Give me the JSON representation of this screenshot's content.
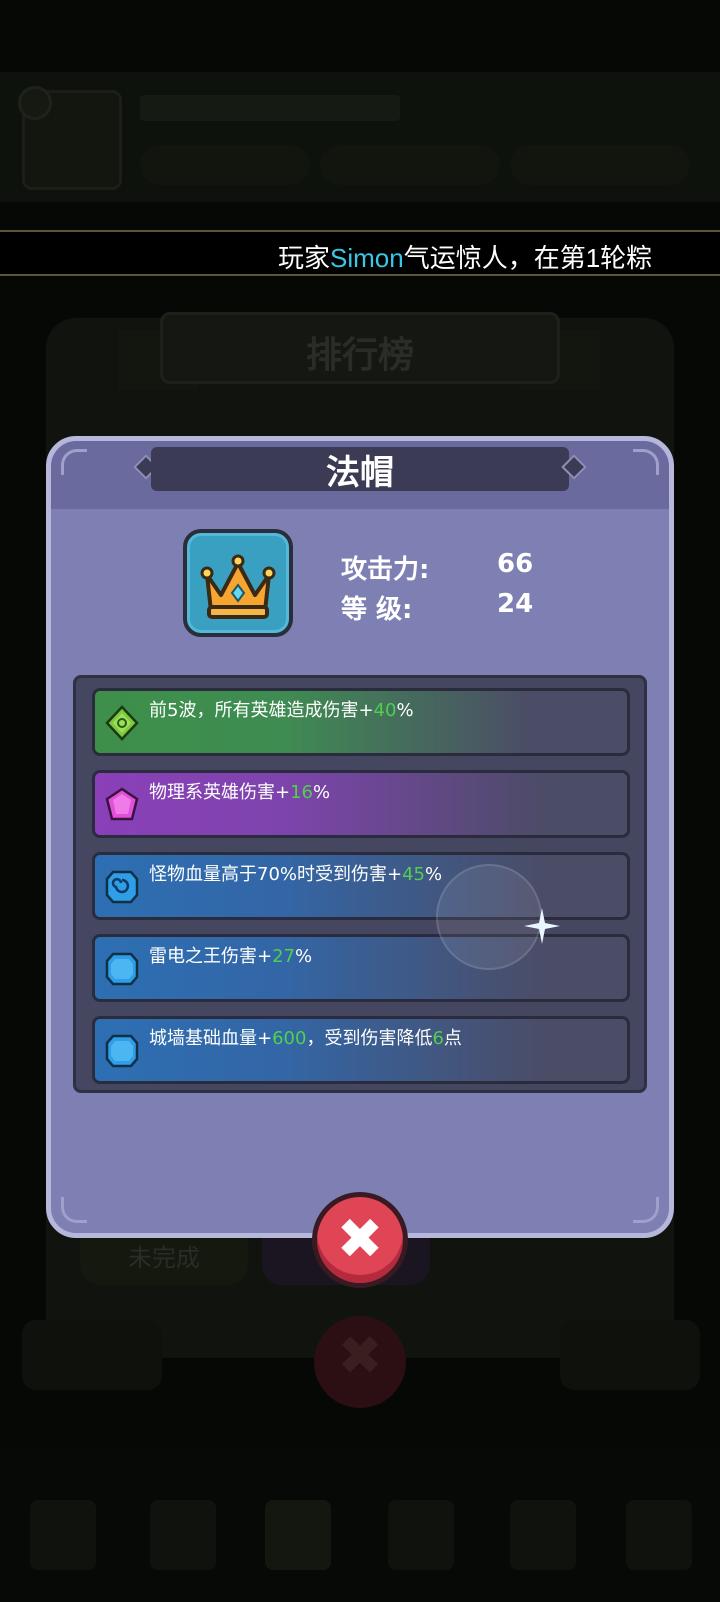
{
  "ticker": {
    "prefix": "玩家",
    "player": "Simon",
    "suffix": "气运惊人，在第1轮粽"
  },
  "background": {
    "ranking_title": "排行榜",
    "button_label": "未完成"
  },
  "dialog": {
    "title": "法帽",
    "item_icon": "crown-icon",
    "stats": [
      {
        "label": "攻击力:",
        "value": "66"
      },
      {
        "label": "等  级:",
        "value": "24"
      }
    ],
    "skills": [
      {
        "icon": "green-rune-gem-icon",
        "color": "green",
        "parts": [
          "前5波，所有英雄造成伤害+",
          "40",
          "%"
        ]
      },
      {
        "icon": "purple-gem-icon",
        "color": "purple",
        "parts": [
          "物理系英雄伤害+",
          "16",
          "%"
        ]
      },
      {
        "icon": "blue-swirl-gem-icon",
        "color": "blue",
        "parts": [
          "怪物血量高于70%时受到伤害+",
          "45",
          "%"
        ]
      },
      {
        "icon": "blue-gem-icon",
        "color": "blue",
        "parts": [
          "雷电之王伤害+",
          "27",
          "%"
        ]
      },
      {
        "icon": "blue-gem-icon",
        "color": "blue",
        "parts": [
          "城墙基础血量+",
          "600",
          "，受到伤害降低",
          "6",
          "点"
        ]
      }
    ],
    "close_icon": "close-x-icon"
  },
  "colors": {
    "dialog_bg": "#7e7fb2",
    "highlight_number": "#4fd04f",
    "ticker_highlight": "#39c7e6",
    "close_button": "#e04556"
  }
}
